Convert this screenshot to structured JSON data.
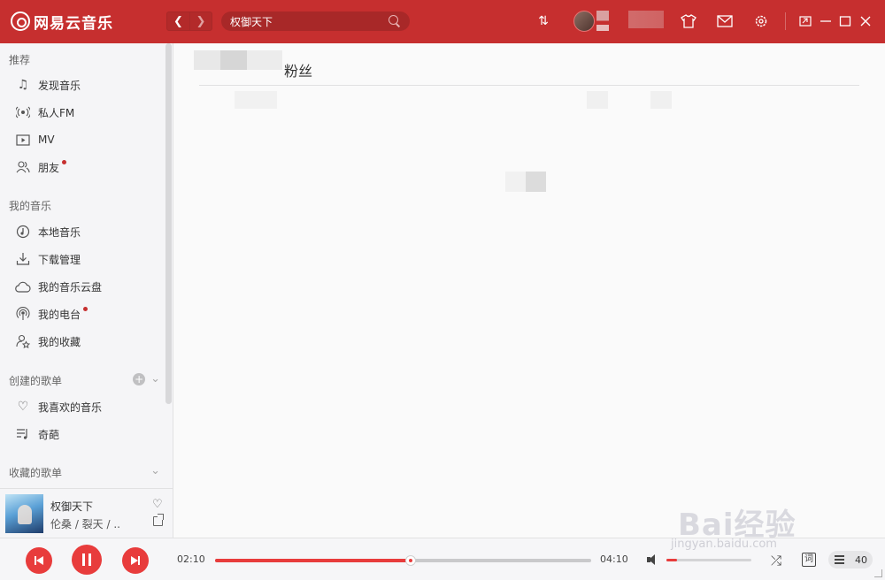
{
  "app": {
    "logo_text": "网易云音乐",
    "accent": "#c62f2f"
  },
  "topbar": {
    "search": {
      "value": "权御天下",
      "placeholder": ""
    },
    "icons": [
      "refresh-icon",
      "skin-icon",
      "mail-icon",
      "settings-icon",
      "mini-mode-icon",
      "minimize-icon",
      "maximize-icon",
      "close-icon"
    ]
  },
  "sidebar": {
    "sections": {
      "recommend": "推荐",
      "my_music": "我的音乐",
      "created_playlists": "创建的歌单",
      "collected_playlists": "收藏的歌单"
    },
    "items": [
      {
        "label": "发现音乐",
        "icon": "music-note-icon"
      },
      {
        "label": "私人FM",
        "icon": "radio-icon"
      },
      {
        "label": "MV",
        "icon": "video-icon"
      },
      {
        "label": "朋友",
        "icon": "friends-icon",
        "dot": true
      },
      {
        "label": "本地音乐",
        "icon": "local-music-icon"
      },
      {
        "label": "下载管理",
        "icon": "download-icon"
      },
      {
        "label": "我的音乐云盘",
        "icon": "cloud-icon"
      },
      {
        "label": "我的电台",
        "icon": "podcast-icon",
        "dot": true
      },
      {
        "label": "我的收藏",
        "icon": "collection-icon"
      },
      {
        "label": "我喜欢的音乐",
        "icon": "heart-icon"
      },
      {
        "label": "奇葩",
        "icon": "playlist-icon"
      }
    ]
  },
  "now_playing": {
    "title": "权御天下",
    "artist": "伦桑 / 裂天 / ..."
  },
  "main": {
    "title": "粉丝"
  },
  "player": {
    "current_time": "02:10",
    "total_time": "04:10",
    "progress": 0.52,
    "volume": 0.12,
    "lyric_label": "词",
    "playlist_count": "40"
  },
  "watermark": {
    "brand": "Bai经验",
    "url": "jingyan.baidu.com"
  }
}
